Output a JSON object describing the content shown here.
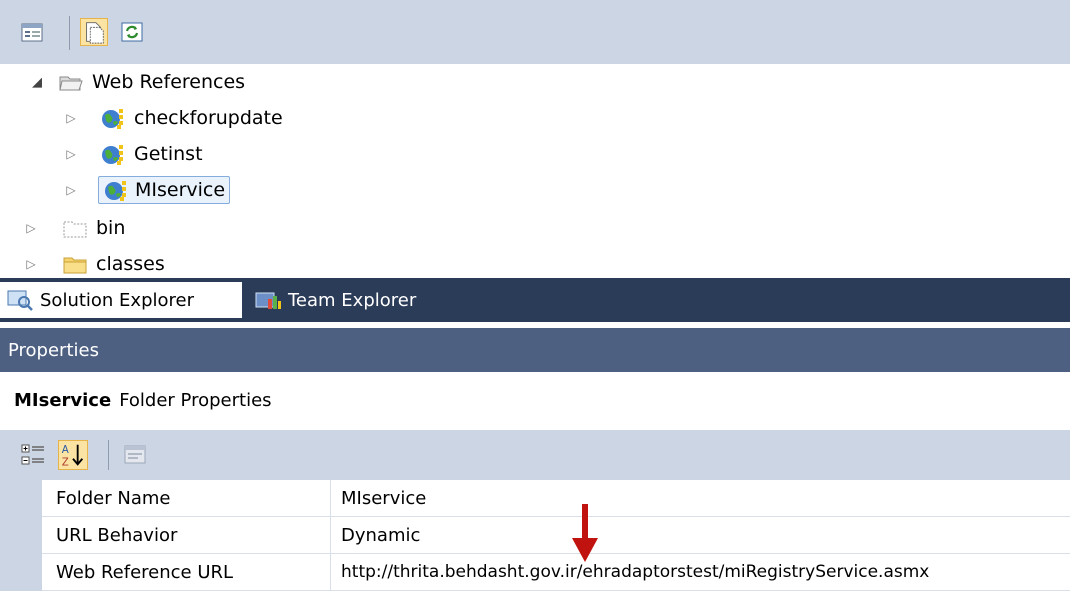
{
  "toolbar": {
    "buttons": [
      {
        "icon": "properties-icon",
        "pressed": false
      },
      {
        "icon": "show-all-files-icon",
        "pressed": true
      },
      {
        "icon": "refresh-icon",
        "pressed": false
      }
    ]
  },
  "tree": {
    "nodes": [
      {
        "label": "Web References",
        "icon": "open-folder-icon",
        "expanded": true
      },
      {
        "label": "checkforupdate",
        "icon": "web-reference-icon",
        "expanded": false
      },
      {
        "label": "Getinst",
        "icon": "web-reference-icon",
        "expanded": false
      },
      {
        "label": "MIservice",
        "icon": "web-reference-icon",
        "expanded": false,
        "selected": true
      },
      {
        "label": "bin",
        "icon": "dotted-folder-icon",
        "expanded": false
      },
      {
        "label": "classes",
        "icon": "folder-icon",
        "expanded": false
      }
    ]
  },
  "tabs": [
    {
      "label": "Solution Explorer",
      "icon": "solution-explorer-icon",
      "active": true
    },
    {
      "label": "Team Explorer",
      "icon": "team-explorer-icon",
      "active": false
    }
  ],
  "properties": {
    "title": "Properties",
    "object_name": "MIservice",
    "object_type": "Folder Properties",
    "toolbar": [
      {
        "icon": "categorized-icon",
        "pressed": false
      },
      {
        "icon": "alphabetical-sort-icon",
        "pressed": true
      },
      {
        "icon": "property-pages-icon",
        "pressed": false
      }
    ],
    "rows": [
      {
        "name": "Folder Name",
        "value": "MIservice"
      },
      {
        "name": "URL Behavior",
        "value": "Dynamic"
      },
      {
        "name": "Web Reference URL",
        "value": "http://thrita.behdasht.gov.ir/ehradaptorstest/miRegistryService.asmx"
      }
    ]
  },
  "annotation": {
    "icon": "red-arrow-icon",
    "color": "#c0120e"
  }
}
